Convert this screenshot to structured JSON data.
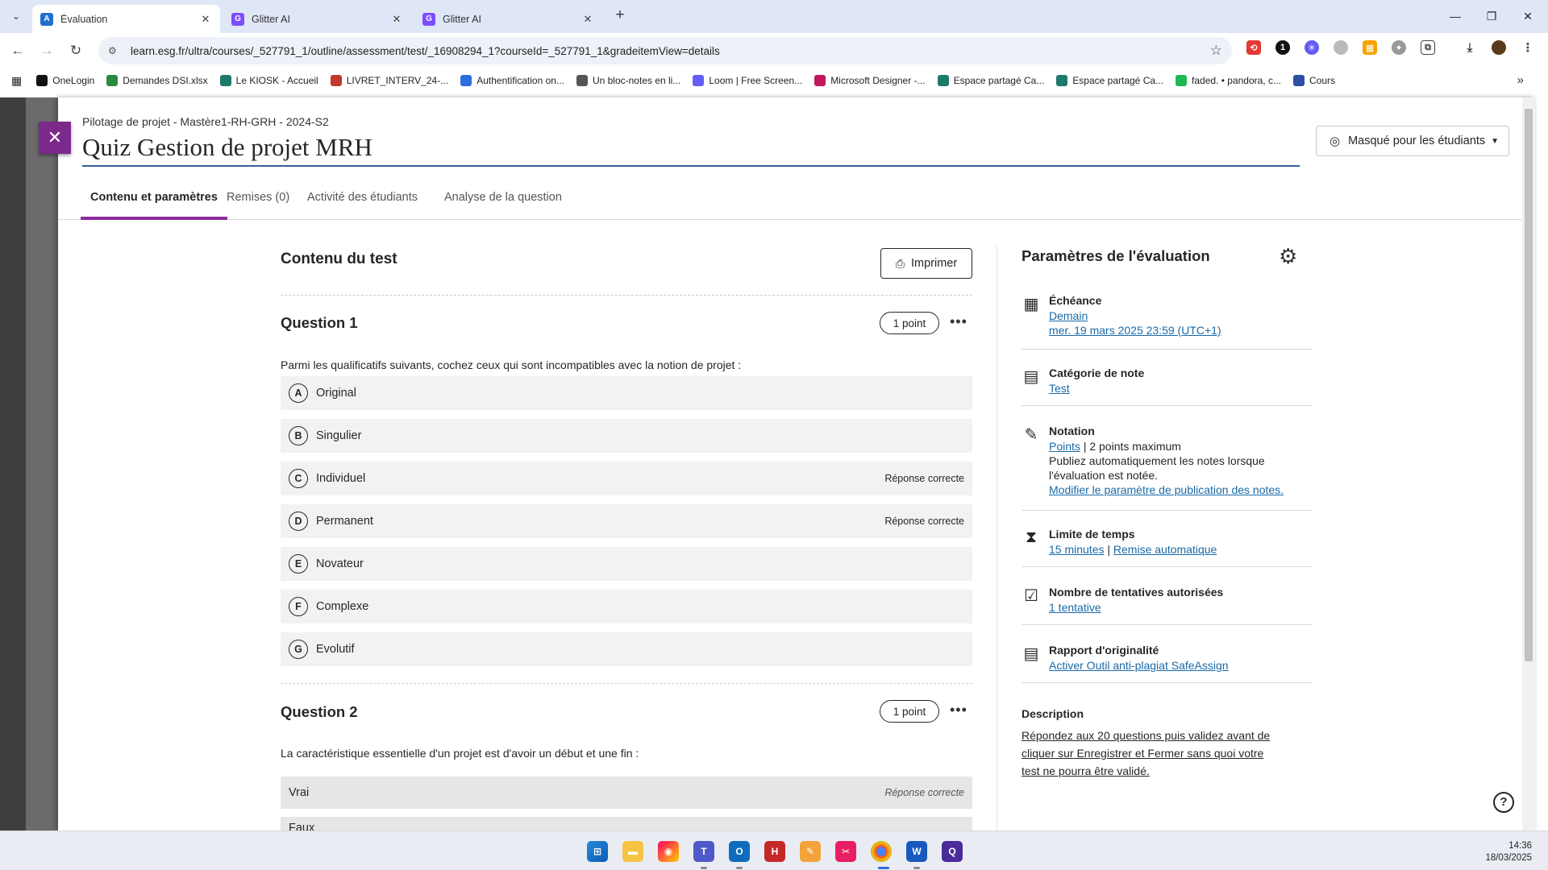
{
  "browser": {
    "tabs": [
      {
        "title": "Évaluation",
        "favicon": "A",
        "active": true
      },
      {
        "title": "Glitter AI",
        "favicon": "G",
        "active": false
      },
      {
        "title": "Glitter AI",
        "favicon": "G",
        "active": false
      }
    ],
    "url": "learn.esg.fr/ultra/courses/_527791_1/outline/assessment/test/_16908294_1?courseId=_527791_1&gradeitemView=details",
    "bookmarks": [
      {
        "label": "OneLogin",
        "color": "#111111"
      },
      {
        "label": "Demandes DSI.xlsx",
        "color": "#2b8a3e"
      },
      {
        "label": "Le KIOSK - Accueil",
        "color": "#1e7a6b"
      },
      {
        "label": "LIVRET_INTERV_24-...",
        "color": "#c0392b"
      },
      {
        "label": "Authentification on...",
        "color": "#2d6cdf"
      },
      {
        "label": "Un bloc-notes en li...",
        "color": "#555555"
      },
      {
        "label": "Loom | Free Screen...",
        "color": "#625df5"
      },
      {
        "label": "Microsoft Designer -...",
        "color": "#c2185b"
      },
      {
        "label": "Espace partagé Ca...",
        "color": "#1e7a6b"
      },
      {
        "label": "Espace partagé Ca...",
        "color": "#1e7a6b"
      },
      {
        "label": "faded. • pandora, c...",
        "color": "#1db954"
      },
      {
        "label": "Cours",
        "color": "#2d4fa3"
      }
    ]
  },
  "header": {
    "breadcrumb": "Pilotage de projet - Mastère1-RH-GRH - 2024-S2",
    "title": "Quiz Gestion de projet MRH",
    "visibility": "Masqué pour les étudiants"
  },
  "tabs": [
    {
      "label": "Contenu et paramètres",
      "active": true
    },
    {
      "label": "Remises (0)",
      "active": false
    },
    {
      "label": "Activité des étudiants",
      "active": false
    },
    {
      "label": "Analyse de la question",
      "active": false
    }
  ],
  "content": {
    "title": "Contenu du test",
    "print_label": "Imprimer",
    "questions": [
      {
        "title": "Question 1",
        "points": "1 point",
        "text": "Parmi les qualificatifs suivants, cochez ceux qui sont incompatibles avec la notion de projet :",
        "answers": [
          {
            "letter": "A",
            "label": "Original",
            "correct": ""
          },
          {
            "letter": "B",
            "label": "Singulier",
            "correct": ""
          },
          {
            "letter": "C",
            "label": "Individuel",
            "correct": "Réponse correcte"
          },
          {
            "letter": "D",
            "label": "Permanent",
            "correct": "Réponse correcte"
          },
          {
            "letter": "E",
            "label": "Novateur",
            "correct": ""
          },
          {
            "letter": "F",
            "label": "Complexe",
            "correct": ""
          },
          {
            "letter": "G",
            "label": "Evolutif",
            "correct": ""
          }
        ]
      },
      {
        "title": "Question 2",
        "points": "1 point",
        "text": "La caractéristique essentielle d'un projet est d'avoir un début et une fin :",
        "answers": [
          {
            "label": "Vrai",
            "correct": "Réponse correcte"
          },
          {
            "label": "Faux",
            "correct": ""
          }
        ]
      }
    ]
  },
  "settings": {
    "title": "Paramètres de l'évaluation",
    "due": {
      "label": "Échéance",
      "relative": "Demain",
      "date": "mer. 19 mars 2025 23:59 (UTC+1)"
    },
    "category": {
      "label": "Catégorie de note",
      "value": "Test"
    },
    "grading": {
      "label": "Notation",
      "link": "Points",
      "max": "2 points maximum",
      "publish_text": "Publiez automatiquement les notes lorsque l'évaluation est notée.",
      "publish_link": "Modifier le paramètre de publication des notes."
    },
    "time_limit": {
      "label": "Limite de temps",
      "value": "15 minutes",
      "mode": "Remise automatique"
    },
    "attempts": {
      "label": "Nombre de tentatives autorisées",
      "value": "1 tentative"
    },
    "originality": {
      "label": "Rapport d'originalité",
      "value": "Activer Outil anti-plagiat SafeAssign"
    },
    "description": {
      "label": "Description",
      "text": "Répondez aux 20 questions puis validez avant de cliquer sur Enregistrer et Fermer sans quoi votre test ne pourra être validé."
    }
  },
  "taskbar": {
    "time": "14:36",
    "date": "18/03/2025"
  }
}
